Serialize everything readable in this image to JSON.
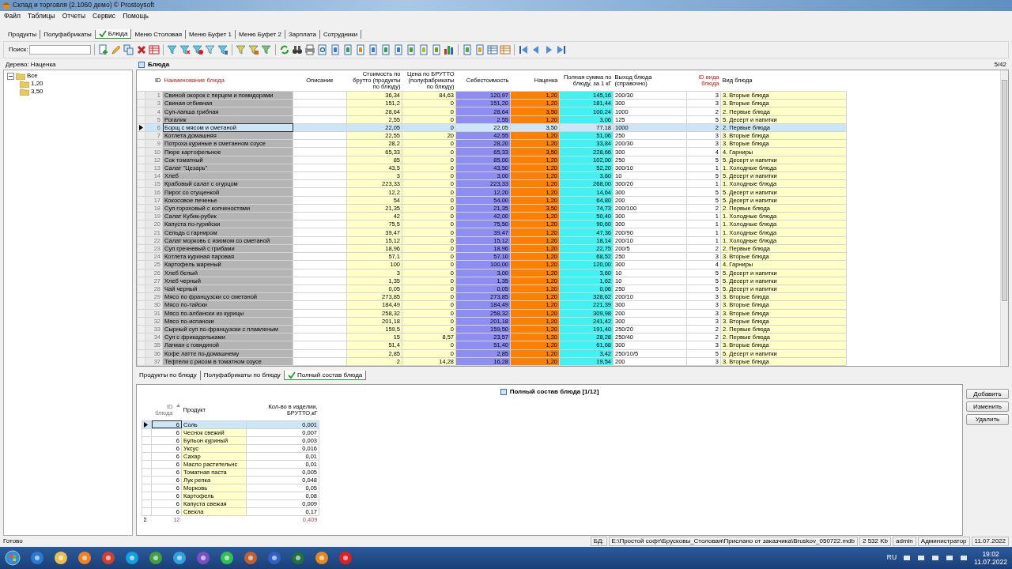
{
  "window": {
    "title": "Склад и торговля (2.1060 демо) © Prostoysoft"
  },
  "menu": [
    "Файл",
    "Таблицы",
    "Отчеты",
    "Сервис",
    "Помощь"
  ],
  "tabs": [
    {
      "label": "Продукты",
      "selected": false
    },
    {
      "label": "Полуфабрикаты",
      "selected": false
    },
    {
      "label": "Блюда",
      "selected": true
    },
    {
      "label": "Меню Столовая",
      "selected": false
    },
    {
      "label": "Меню Буфет 1",
      "selected": false
    },
    {
      "label": "Меню Буфет 2",
      "selected": false
    },
    {
      "label": "Зарплата",
      "selected": false
    },
    {
      "label": "Сотрудники",
      "selected": false
    }
  ],
  "search": {
    "label": "Поиск:"
  },
  "tree": {
    "title": "Дерево: Наценка",
    "items": [
      {
        "label": "Все",
        "expanded": true,
        "children": [
          {
            "label": "1,20"
          },
          {
            "label": "3,50"
          }
        ]
      }
    ]
  },
  "grid": {
    "title": "Блюда",
    "position": "5/42",
    "columns": [
      {
        "label": "ID",
        "emphasized": false
      },
      {
        "label": "Наименование блюда",
        "emphasized": true
      },
      {
        "label": "Описание",
        "emphasized": false
      },
      {
        "label": "Стоимость по брутто (продукты по блюду)",
        "emphasized": false
      },
      {
        "label": "Цена по БРУТТО (полуфабрикаты по блюду)",
        "emphasized": false
      },
      {
        "label": "Себестоимость",
        "emphasized": false
      },
      {
        "label": "Наценка",
        "emphasized": false
      },
      {
        "label": "Полная сумма по блюду, за 1 кГ",
        "emphasized": false
      },
      {
        "label": "Выход блюда (справочно)",
        "emphasized": false
      },
      {
        "label": "ID вида блюда",
        "emphasized": true
      },
      {
        "label": "Вид блюда",
        "emphasized": false
      }
    ],
    "rows": [
      {
        "id": "1",
        "name": "Свиной окорок с перцем и помидорами",
        "cost": "36,34",
        "price": "84,63",
        "prime_cost": "120,97",
        "markup": "1,20",
        "total": "145,16",
        "output": "200/30",
        "type_id": "3",
        "type": "3. Вторые блюда",
        "selected": false
      },
      {
        "id": "3",
        "name": "Свиная отбивная",
        "cost": "151,2",
        "price": "0",
        "prime_cost": "151,20",
        "markup": "1,20",
        "total": "181,44",
        "output": "300",
        "type_id": "3",
        "type": "3. Вторые блюда",
        "selected": false
      },
      {
        "id": "4",
        "name": "Суп-лапша грибная",
        "cost": "28,64",
        "price": "0",
        "prime_cost": "28,64",
        "markup": "3,50",
        "total": "100,24",
        "output": "1000",
        "type_id": "2",
        "type": "2. Первые блюда",
        "selected": false
      },
      {
        "id": "5",
        "name": "Рогалик",
        "cost": "2,55",
        "price": "0",
        "prime_cost": "2,55",
        "markup": "1,20",
        "total": "3,06",
        "output": "125",
        "type_id": "5",
        "type": "5. Десерт и напитки",
        "selected": false
      },
      {
        "id": "6",
        "name": "Борщ с мясом и сметаной",
        "cost": "22,05",
        "price": "0",
        "prime_cost": "22,05",
        "markup": "3,50",
        "total": "77,18",
        "output": "1000",
        "type_id": "2",
        "type": "2. Первые блюда",
        "selected": true
      },
      {
        "id": "7",
        "name": "Котлета домашняя",
        "cost": "22,55",
        "price": "20",
        "prime_cost": "42,55",
        "markup": "1,20",
        "total": "51,06",
        "output": "250",
        "type_id": "3",
        "type": "3. Вторые блюда",
        "selected": false
      },
      {
        "id": "9",
        "name": "Потроха куриные в сметанном соусе",
        "cost": "28,2",
        "price": "0",
        "prime_cost": "28,20",
        "markup": "1,20",
        "total": "33,84",
        "output": "200/30",
        "type_id": "3",
        "type": "3. Вторые блюда",
        "selected": false
      },
      {
        "id": "10",
        "name": "Пюре картофельное",
        "cost": "65,33",
        "price": "0",
        "prime_cost": "65,33",
        "markup": "3,50",
        "total": "228,66",
        "output": "300",
        "type_id": "4",
        "type": "4. Гарниры",
        "selected": false
      },
      {
        "id": "12",
        "name": "Сок томатный",
        "cost": "85",
        "price": "0",
        "prime_cost": "85,00",
        "markup": "1,20",
        "total": "102,00",
        "output": "250",
        "type_id": "5",
        "type": "5. Десерт и напитки",
        "selected": false
      },
      {
        "id": "13",
        "name": "Салат \"Цезарь\"",
        "cost": "43,5",
        "price": "0",
        "prime_cost": "43,50",
        "markup": "1,20",
        "total": "52,20",
        "output": "300/10",
        "type_id": "1",
        "type": "1. Холодные блюда",
        "selected": false
      },
      {
        "id": "14",
        "name": "Хлеб",
        "cost": "3",
        "price": "0",
        "prime_cost": "3,00",
        "markup": "1,20",
        "total": "3,60",
        "output": "10",
        "type_id": "5",
        "type": "5. Десерт и напитки",
        "selected": false
      },
      {
        "id": "15",
        "name": "Крабовый салат с огурцом",
        "cost": "223,33",
        "price": "0",
        "prime_cost": "223,33",
        "markup": "1,20",
        "total": "268,00",
        "output": "300/20",
        "type_id": "1",
        "type": "1. Холодные блюда",
        "selected": false
      },
      {
        "id": "16",
        "name": "Пирог со сгущенкой",
        "cost": "12,2",
        "price": "0",
        "prime_cost": "12,20",
        "markup": "1,20",
        "total": "14,64",
        "output": "300",
        "type_id": "5",
        "type": "5. Десерт и напитки",
        "selected": false
      },
      {
        "id": "17",
        "name": "Кокосовое печенье",
        "cost": "54",
        "price": "0",
        "prime_cost": "54,00",
        "markup": "1,20",
        "total": "64,80",
        "output": "200",
        "type_id": "5",
        "type": "5. Десерт и напитки",
        "selected": false
      },
      {
        "id": "18",
        "name": "Суп гороховый с копченостями",
        "cost": "21,35",
        "price": "0",
        "prime_cost": "21,35",
        "markup": "3,50",
        "total": "74,73",
        "output": "200/100",
        "type_id": "2",
        "type": "2. Первые блюда",
        "selected": false
      },
      {
        "id": "19",
        "name": "Салат Кубик-рубик",
        "cost": "42",
        "price": "0",
        "prime_cost": "42,00",
        "markup": "1,20",
        "total": "50,40",
        "output": "300",
        "type_id": "1",
        "type": "1. Холодные блюда",
        "selected": false
      },
      {
        "id": "20",
        "name": "Капуста по-гурийски",
        "cost": "75,5",
        "price": "0",
        "prime_cost": "75,50",
        "markup": "1,20",
        "total": "90,60",
        "output": "300",
        "type_id": "1",
        "type": "1. Холодные блюда",
        "selected": false
      },
      {
        "id": "21",
        "name": "Сельдь с гарниром",
        "cost": "39,47",
        "price": "0",
        "prime_cost": "39,47",
        "markup": "1,20",
        "total": "47,36",
        "output": "200/90",
        "type_id": "1",
        "type": "1. Холодные блюда",
        "selected": false
      },
      {
        "id": "22",
        "name": "Салат морковь с изюмом со сметаной",
        "cost": "15,12",
        "price": "0",
        "prime_cost": "15,12",
        "markup": "1,20",
        "total": "18,14",
        "output": "200/10",
        "type_id": "1",
        "type": "1. Холодные блюда",
        "selected": false
      },
      {
        "id": "23",
        "name": "Суп гречневый с грибами",
        "cost": "18,96",
        "price": "0",
        "prime_cost": "18,96",
        "markup": "1,20",
        "total": "22,75",
        "output": "200/5",
        "type_id": "2",
        "type": "2. Первые блюда",
        "selected": false
      },
      {
        "id": "24",
        "name": "Котлета куриная паровая",
        "cost": "57,1",
        "price": "0",
        "prime_cost": "57,10",
        "markup": "1,20",
        "total": "68,52",
        "output": "250",
        "type_id": "3",
        "type": "3. Вторые блюда",
        "selected": false
      },
      {
        "id": "25",
        "name": "Картофель жареный",
        "cost": "100",
        "price": "0",
        "prime_cost": "100,00",
        "markup": "1,20",
        "total": "120,00",
        "output": "300",
        "type_id": "4",
        "type": "4. Гарниры",
        "selected": false
      },
      {
        "id": "26",
        "name": "Хлеб белый",
        "cost": "3",
        "price": "0",
        "prime_cost": "3,00",
        "markup": "1,20",
        "total": "3,60",
        "output": "10",
        "type_id": "5",
        "type": "5. Десерт и напитки",
        "selected": false
      },
      {
        "id": "27",
        "name": "Хлеб черный",
        "cost": "1,35",
        "price": "0",
        "prime_cost": "1,35",
        "markup": "1,20",
        "total": "1,62",
        "output": "10",
        "type_id": "5",
        "type": "5. Десерт и напитки",
        "selected": false
      },
      {
        "id": "28",
        "name": "Чай черный",
        "cost": "0,05",
        "price": "0",
        "prime_cost": "0,05",
        "markup": "1,20",
        "total": "0,06",
        "output": "250",
        "type_id": "5",
        "type": "5. Десерт и напитки",
        "selected": false
      },
      {
        "id": "29",
        "name": "Мясо по французски со сметаной",
        "cost": "273,85",
        "price": "0",
        "prime_cost": "273,85",
        "markup": "1,20",
        "total": "328,62",
        "output": "200/10",
        "type_id": "3",
        "type": "3. Вторые блюда",
        "selected": false
      },
      {
        "id": "30",
        "name": "Мясо по-тайски",
        "cost": "184,49",
        "price": "0",
        "prime_cost": "184,49",
        "markup": "1,20",
        "total": "221,39",
        "output": "300",
        "type_id": "3",
        "type": "3. Вторые блюда",
        "selected": false
      },
      {
        "id": "31",
        "name": "Мясо по-албански из курицы",
        "cost": "258,32",
        "price": "0",
        "prime_cost": "258,32",
        "markup": "1,20",
        "total": "309,98",
        "output": "200",
        "type_id": "3",
        "type": "3. Вторые блюда",
        "selected": false
      },
      {
        "id": "32",
        "name": "Мясо по-испански",
        "cost": "201,18",
        "price": "0",
        "prime_cost": "201,18",
        "markup": "1,20",
        "total": "241,42",
        "output": "300",
        "type_id": "3",
        "type": "3. Вторые блюда",
        "selected": false
      },
      {
        "id": "33",
        "name": "Сырный суп по-французски с плавленым",
        "cost": "159,5",
        "price": "0",
        "prime_cost": "159,50",
        "markup": "1,20",
        "total": "191,40",
        "output": "250/20",
        "type_id": "2",
        "type": "2. Первые блюда",
        "selected": false
      },
      {
        "id": "34",
        "name": "Суп с фрикадельками",
        "cost": "15",
        "price": "8,57",
        "prime_cost": "23,57",
        "markup": "1,20",
        "total": "28,28",
        "output": "250/40",
        "type_id": "2",
        "type": "2. Первые блюда",
        "selected": false
      },
      {
        "id": "35",
        "name": "Лагман с говядиной",
        "cost": "51,4",
        "price": "0",
        "prime_cost": "51,40",
        "markup": "1,20",
        "total": "61,68",
        "output": "300",
        "type_id": "3",
        "type": "3. Вторые блюда",
        "selected": false
      },
      {
        "id": "36",
        "name": "Кофе латте по-домашнему",
        "cost": "2,85",
        "price": "0",
        "prime_cost": "2,85",
        "markup": "1,20",
        "total": "3,42",
        "output": "250/10/5",
        "type_id": "5",
        "type": "5. Десерт и напитки",
        "selected": false
      },
      {
        "id": "37",
        "name": "Тефтели с рисом в томатном соусе",
        "cost": "2",
        "price": "14,28",
        "prime_cost": "16,28",
        "markup": "1,20",
        "total": "19,54",
        "output": "200",
        "type_id": "3",
        "type": "3. Вторые блюда",
        "selected": false
      }
    ]
  },
  "detail_tabs": [
    {
      "label": "Продукты по блюду",
      "selected": false
    },
    {
      "label": "Полуфабрикаты по блюду",
      "selected": false
    },
    {
      "label": "Полный состав блюда",
      "selected": true
    }
  ],
  "detail": {
    "title": "Полный состав блюда [1/12]",
    "columns": [
      "ID блюда",
      "Продукт",
      "Кол-во в изделии, БРУТТО,кГ"
    ],
    "rows": [
      {
        "dish_id": "6",
        "product": "Соль",
        "qty": "0,001",
        "selected": true
      },
      {
        "dish_id": "6",
        "product": "Чеснок свежий",
        "qty": "0,007",
        "selected": false
      },
      {
        "dish_id": "6",
        "product": "Бульон куриный",
        "qty": "0,003",
        "selected": false
      },
      {
        "dish_id": "6",
        "product": "Уксус",
        "qty": "0,016",
        "selected": false
      },
      {
        "dish_id": "6",
        "product": "Сахар",
        "qty": "0,01",
        "selected": false
      },
      {
        "dish_id": "6",
        "product": "Масло растительнс",
        "qty": "0,01",
        "selected": false
      },
      {
        "dish_id": "6",
        "product": "Томатная паста",
        "qty": "0,005",
        "selected": false
      },
      {
        "dish_id": "6",
        "product": "Лук репка",
        "qty": "0,048",
        "selected": false
      },
      {
        "dish_id": "6",
        "product": "Морковь",
        "qty": "0,05",
        "selected": false
      },
      {
        "dish_id": "6",
        "product": "Картофель",
        "qty": "0,08",
        "selected": false
      },
      {
        "dish_id": "6",
        "product": "Капуста свежая",
        "qty": "0,009",
        "selected": false
      },
      {
        "dish_id": "6",
        "product": "Свекла",
        "qty": "0,17",
        "selected": false
      }
    ],
    "total": {
      "symbol": "Σ",
      "count": "12",
      "qty": "0,409"
    }
  },
  "buttons": [
    "Добавить",
    "Изменить",
    "Удалить"
  ],
  "status_bar": {
    "state": "Готово",
    "db_label": "БД:",
    "db_path": "E:\\Простой софт\\Брусковы_Столовая\\Прислано от заказчика\\Bruskov_050722.mdb",
    "db_size": "2 532 Kb",
    "user": "admin",
    "role": "Администратор",
    "date": "11.07.2022"
  },
  "taskbar": {
    "language": "RU",
    "time": "19:02",
    "date": "11.07.2022"
  }
}
